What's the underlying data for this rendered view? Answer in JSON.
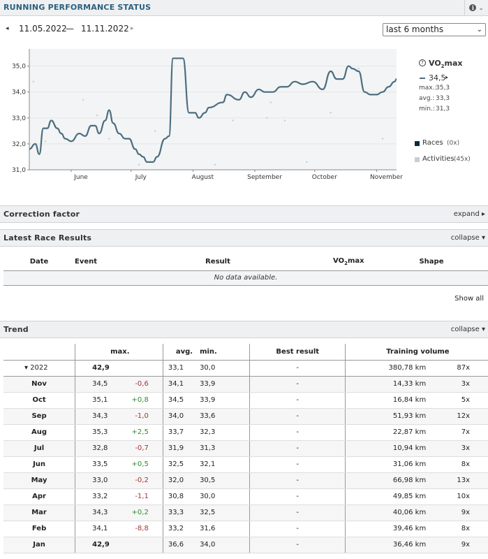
{
  "header": {
    "title": "RUNNING PERFORMANCE STATUS",
    "info_icon": "info-icon"
  },
  "date_range": {
    "prev_icon": "◂",
    "from": "11.05.2022",
    "separator": "—",
    "to": "11.11.2022",
    "next_icon": "▸",
    "period": "last 6 months"
  },
  "chart_data": {
    "type": "line",
    "y_ticks": [
      "35,0",
      "34,0",
      "33,0",
      "32,0",
      "31,0"
    ],
    "x_ticks": [
      "June",
      "July",
      "August",
      "September",
      "October",
      "November"
    ],
    "ylim": [
      31.0,
      35.5
    ],
    "series": [
      {
        "name": "VO2max",
        "x": [
          "2022-05-11",
          "2022-05-14",
          "2022-05-16",
          "2022-05-18",
          "2022-05-20",
          "2022-05-22",
          "2022-05-25",
          "2022-05-27",
          "2022-05-29",
          "2022-06-01",
          "2022-06-05",
          "2022-06-08",
          "2022-06-11",
          "2022-06-13",
          "2022-06-15",
          "2022-06-18",
          "2022-06-20",
          "2022-06-22",
          "2022-06-25",
          "2022-06-28",
          "2022-06-30",
          "2022-07-03",
          "2022-07-05",
          "2022-07-07",
          "2022-07-09",
          "2022-07-12",
          "2022-07-14",
          "2022-07-18",
          "2022-07-20",
          "2022-07-22",
          "2022-07-27",
          "2022-07-30",
          "2022-08-02",
          "2022-08-04",
          "2022-08-07",
          "2022-08-09",
          "2022-08-16",
          "2022-08-18",
          "2022-08-24",
          "2022-08-27",
          "2022-08-30",
          "2022-09-03",
          "2022-09-06",
          "2022-09-10",
          "2022-09-14",
          "2022-09-17",
          "2022-09-21",
          "2022-09-25",
          "2022-09-30",
          "2022-10-05",
          "2022-10-09",
          "2022-10-12",
          "2022-10-15",
          "2022-10-18",
          "2022-10-20",
          "2022-10-23",
          "2022-10-26",
          "2022-10-29",
          "2022-11-01",
          "2022-11-04",
          "2022-11-07",
          "2022-11-10",
          "2022-11-11"
        ],
        "y": [
          31.8,
          32.0,
          31.6,
          32.6,
          32.6,
          32.9,
          32.6,
          32.4,
          32.2,
          32.1,
          32.4,
          32.3,
          32.7,
          32.7,
          32.4,
          32.9,
          33.3,
          32.8,
          32.4,
          32.2,
          32.2,
          31.8,
          31.6,
          31.5,
          31.3,
          31.3,
          31.5,
          32.2,
          32.3,
          35.3,
          35.3,
          33.2,
          33.2,
          33.0,
          33.2,
          33.4,
          33.6,
          33.9,
          33.7,
          34.0,
          33.8,
          34.1,
          34.0,
          34.0,
          34.2,
          34.2,
          34.4,
          34.3,
          34.4,
          34.1,
          34.8,
          34.5,
          34.5,
          35.0,
          34.9,
          34.8,
          34.0,
          33.9,
          33.9,
          34.0,
          34.2,
          34.4,
          34.5
        ],
        "color": "#4c6d80"
      },
      {
        "name": "Activities",
        "x": [
          "2022-05-13",
          "2022-05-19",
          "2022-05-24",
          "2022-06-01",
          "2022-06-07",
          "2022-06-14",
          "2022-06-20",
          "2022-07-05",
          "2022-07-13",
          "2022-08-12",
          "2022-08-21",
          "2022-09-07",
          "2022-09-09",
          "2022-09-16",
          "2022-09-27",
          "2022-10-09",
          "2022-10-23",
          "2022-11-04"
        ],
        "y": [
          34.4,
          32.1,
          32.7,
          32.1,
          33.7,
          33.1,
          32.2,
          31.2,
          32.5,
          31.2,
          32.9,
          33.0,
          33.6,
          32.9,
          31.3,
          33.2,
          34.9,
          32.2
        ],
        "color": "#c5ced3"
      }
    ],
    "legend": {
      "help_icon": "?",
      "title_main": "VO",
      "title_sub": "2",
      "title_tail": "max",
      "current": "34,5",
      "max_label": "max.:",
      "max": "35,3",
      "avg_label": "avg.:",
      "avg": "33,3",
      "min_label": "min.:",
      "min": "31,3",
      "races_label": "Races",
      "races_count": "(0x)",
      "activities_label": "Activities",
      "activities_count": "(45x)"
    }
  },
  "correction": {
    "title": "Correction factor",
    "action": "expand ▸"
  },
  "races": {
    "title": "Latest Race Results",
    "action": "collapse ▾",
    "columns": [
      "Date",
      "Event",
      "Result",
      "VO",
      "2",
      "max",
      "Shape"
    ],
    "empty": "No data available.",
    "show_all": "Show all"
  },
  "trend": {
    "title": "Trend",
    "action": "collapse ▾",
    "columns": {
      "max": "max.",
      "avg": "avg.",
      "min": "min.",
      "best": "Best result",
      "volume": "Training volume"
    },
    "year": {
      "label": "▾ 2022",
      "max": "42,9",
      "avg": "33,1",
      "min": "30,0",
      "best": "-",
      "km": "380,78 km",
      "count": "87x"
    },
    "rows": [
      {
        "month": "Nov",
        "max": "34,5",
        "diff": "-0,6",
        "avg": "34,1",
        "min": "33,9",
        "best": "-",
        "km": "14,33 km",
        "count": "3x"
      },
      {
        "month": "Oct",
        "max": "35,1",
        "diff": "+0,8",
        "avg": "34,5",
        "min": "33,9",
        "best": "-",
        "km": "16,84 km",
        "count": "5x"
      },
      {
        "month": "Sep",
        "max": "34,3",
        "diff": "-1,0",
        "avg": "34,0",
        "min": "33,6",
        "best": "-",
        "km": "51,93 km",
        "count": "12x"
      },
      {
        "month": "Aug",
        "max": "35,3",
        "diff": "+2,5",
        "avg": "33,7",
        "min": "32,3",
        "best": "-",
        "km": "22,87 km",
        "count": "7x"
      },
      {
        "month": "Jul",
        "max": "32,8",
        "diff": "-0,7",
        "avg": "31,9",
        "min": "31,3",
        "best": "-",
        "km": "10,94 km",
        "count": "3x"
      },
      {
        "month": "Jun",
        "max": "33,5",
        "diff": "+0,5",
        "avg": "32,5",
        "min": "32,1",
        "best": "-",
        "km": "31,06 km",
        "count": "8x"
      },
      {
        "month": "May",
        "max": "33,0",
        "diff": "-0,2",
        "avg": "32,0",
        "min": "30,5",
        "best": "-",
        "km": "66,98 km",
        "count": "13x"
      },
      {
        "month": "Apr",
        "max": "33,2",
        "diff": "-1,1",
        "avg": "30,8",
        "min": "30,0",
        "best": "-",
        "km": "49,85 km",
        "count": "10x"
      },
      {
        "month": "Mar",
        "max": "34,3",
        "diff": "+0,2",
        "avg": "33,3",
        "min": "32,5",
        "best": "-",
        "km": "40,06 km",
        "count": "9x"
      },
      {
        "month": "Feb",
        "max": "34,1",
        "diff": "-8,8",
        "avg": "33,2",
        "min": "31,6",
        "best": "-",
        "km": "39,46 km",
        "count": "8x"
      },
      {
        "month": "Jan",
        "max": "42,9",
        "diff": "",
        "avg": "36,6",
        "min": "34,0",
        "best": "-",
        "km": "36,46 km",
        "count": "9x"
      }
    ]
  }
}
